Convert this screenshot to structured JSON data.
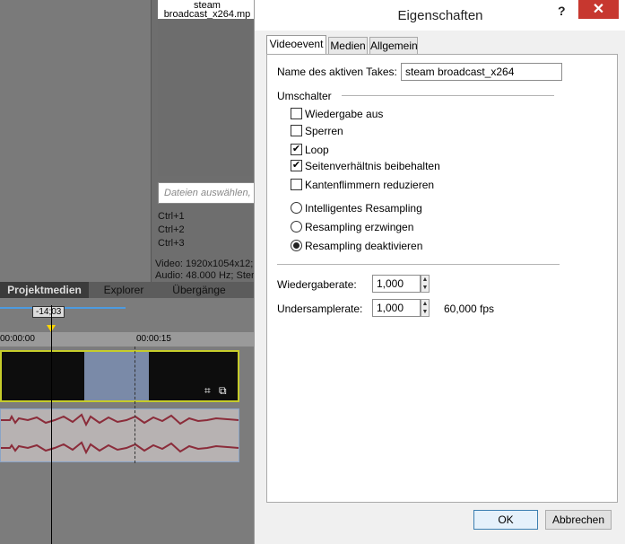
{
  "background": {
    "thumbnail_label_line1": "steam",
    "thumbnail_label_line2": "broadcast_x264.mp",
    "search_placeholder": "Dateien auswählen, u",
    "shortcuts": [
      "Ctrl+1",
      "Ctrl+2",
      "Ctrl+3"
    ],
    "media_info_video": "Video: 1920x1054x12;",
    "media_info_audio": "Audio: 48.000 Hz; Ster",
    "tabs": [
      {
        "label": "Projektmedien"
      },
      {
        "label": "Explorer"
      },
      {
        "label": "Übergänge"
      }
    ],
    "position_label": "-14;03",
    "ruler_start": "00:00:00",
    "ruler_mid": "00:00:15"
  },
  "dialog": {
    "title": "Eigenschaften",
    "help": "?",
    "close": "✕",
    "tabs": [
      {
        "label": "Videoevent",
        "active": true
      },
      {
        "label": "Medien",
        "active": false
      },
      {
        "label": "Allgemein",
        "active": false
      }
    ],
    "take_label": "Name des aktiven Takes:",
    "take_value": "steam broadcast_x264",
    "switches_label": "Umschalter",
    "checkboxes": [
      {
        "label": "Wiedergabe aus",
        "checked": false
      },
      {
        "label": "Sperren",
        "checked": false
      },
      {
        "label": "Loop",
        "checked": true
      },
      {
        "label": "Seitenverhältnis beibehalten",
        "checked": true
      },
      {
        "label": "Kantenflimmern reduzieren",
        "checked": false
      }
    ],
    "radios": [
      {
        "label": "Intelligentes Resampling",
        "selected": false
      },
      {
        "label": "Resampling erzwingen",
        "selected": false
      },
      {
        "label": "Resampling deaktivieren",
        "selected": true
      }
    ],
    "playback_rate_label": "Wiedergaberate:",
    "playback_rate_value": "1,000",
    "undersample_label": "Undersamplerate:",
    "undersample_value": "1,000",
    "fps_label": "60,000 fps",
    "ok": "OK",
    "cancel": "Abbrechen"
  },
  "colors": {
    "close_button": "#c7372f",
    "video_event_border": "#c6cc2a",
    "audio_waveform": "#8b2c3a"
  }
}
